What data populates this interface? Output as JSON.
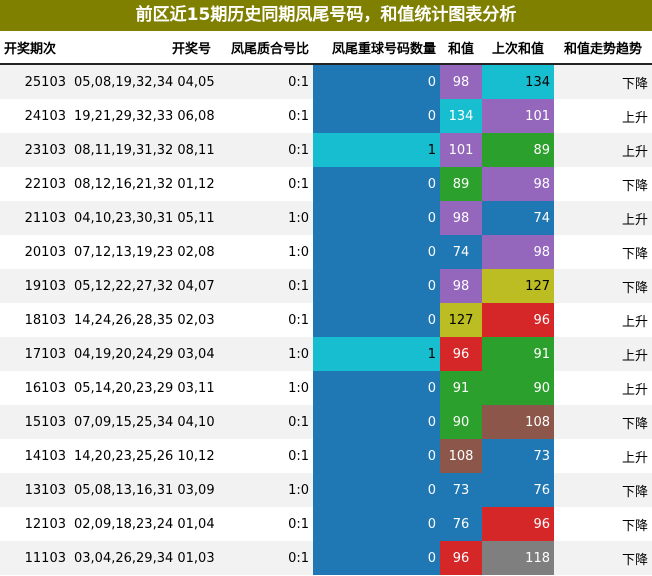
{
  "title": "前区近15期历史同期凤尾号码，和值统计图表分析",
  "headers": {
    "issue": "开奖期次",
    "numbers": "开奖号",
    "parity": "凤尾质合号比",
    "repeat": "凤尾重球号码数量",
    "sum": "和值",
    "prev_sum": "上次和值",
    "trend": "和值走势趋势"
  },
  "colors": {
    "title_bg": "#7f7f00",
    "blue": "#1f77b4",
    "cyan": "#17becf",
    "purple": "#9467bd",
    "green": "#2ca02c",
    "olive": "#bcbd22",
    "red": "#d62728",
    "brown": "#8c564b",
    "gray": "#7f7f7f"
  },
  "rows": [
    {
      "issue": "25103",
      "numbers": "05,08,19,32,34 04,05",
      "parity": "0:1",
      "repeat": "0",
      "repeat_color": "blue",
      "sum": "98",
      "sum_color": "purple",
      "prev_sum": "134",
      "prev_color": "cyan",
      "trend": "下降"
    },
    {
      "issue": "24103",
      "numbers": "19,21,29,32,33 06,08",
      "parity": "0:1",
      "repeat": "0",
      "repeat_color": "blue",
      "sum": "134",
      "sum_color": "cyan",
      "prev_sum": "101",
      "prev_color": "purple",
      "trend": "上升"
    },
    {
      "issue": "23103",
      "numbers": "08,11,19,31,32 08,11",
      "parity": "0:1",
      "repeat": "1",
      "repeat_color": "cyan",
      "sum": "101",
      "sum_color": "purple",
      "prev_sum": "89",
      "prev_color": "green",
      "trend": "上升"
    },
    {
      "issue": "22103",
      "numbers": "08,12,16,21,32 01,12",
      "parity": "0:1",
      "repeat": "0",
      "repeat_color": "blue",
      "sum": "89",
      "sum_color": "green",
      "prev_sum": "98",
      "prev_color": "purple",
      "trend": "下降"
    },
    {
      "issue": "21103",
      "numbers": "04,10,23,30,31 05,11",
      "parity": "1:0",
      "repeat": "0",
      "repeat_color": "blue",
      "sum": "98",
      "sum_color": "purple",
      "prev_sum": "74",
      "prev_color": "blue",
      "trend": "上升"
    },
    {
      "issue": "20103",
      "numbers": "07,12,13,19,23 02,08",
      "parity": "1:0",
      "repeat": "0",
      "repeat_color": "blue",
      "sum": "74",
      "sum_color": "blue",
      "prev_sum": "98",
      "prev_color": "purple",
      "trend": "下降"
    },
    {
      "issue": "19103",
      "numbers": "05,12,22,27,32 04,07",
      "parity": "0:1",
      "repeat": "0",
      "repeat_color": "blue",
      "sum": "98",
      "sum_color": "purple",
      "prev_sum": "127",
      "prev_color": "olive",
      "trend": "下降"
    },
    {
      "issue": "18103",
      "numbers": "14,24,26,28,35 02,03",
      "parity": "0:1",
      "repeat": "0",
      "repeat_color": "blue",
      "sum": "127",
      "sum_color": "olive",
      "prev_sum": "96",
      "prev_color": "red",
      "trend": "上升"
    },
    {
      "issue": "17103",
      "numbers": "04,19,20,24,29 03,04",
      "parity": "1:0",
      "repeat": "1",
      "repeat_color": "cyan",
      "sum": "96",
      "sum_color": "red",
      "prev_sum": "91",
      "prev_color": "green",
      "trend": "上升"
    },
    {
      "issue": "16103",
      "numbers": "05,14,20,23,29 03,11",
      "parity": "1:0",
      "repeat": "0",
      "repeat_color": "blue",
      "sum": "91",
      "sum_color": "green",
      "prev_sum": "90",
      "prev_color": "green",
      "trend": "上升"
    },
    {
      "issue": "15103",
      "numbers": "07,09,15,25,34 04,10",
      "parity": "0:1",
      "repeat": "0",
      "repeat_color": "blue",
      "sum": "90",
      "sum_color": "green",
      "prev_sum": "108",
      "prev_color": "brown",
      "trend": "下降"
    },
    {
      "issue": "14103",
      "numbers": "14,20,23,25,26 10,12",
      "parity": "0:1",
      "repeat": "0",
      "repeat_color": "blue",
      "sum": "108",
      "sum_color": "brown",
      "prev_sum": "73",
      "prev_color": "blue",
      "trend": "上升"
    },
    {
      "issue": "13103",
      "numbers": "05,08,13,16,31 03,09",
      "parity": "1:0",
      "repeat": "0",
      "repeat_color": "blue",
      "sum": "73",
      "sum_color": "blue",
      "prev_sum": "76",
      "prev_color": "blue",
      "trend": "下降"
    },
    {
      "issue": "12103",
      "numbers": "02,09,18,23,24 01,04",
      "parity": "0:1",
      "repeat": "0",
      "repeat_color": "blue",
      "sum": "76",
      "sum_color": "blue",
      "prev_sum": "96",
      "prev_color": "red",
      "trend": "下降"
    },
    {
      "issue": "11103",
      "numbers": "03,04,26,29,34 01,03",
      "parity": "0:1",
      "repeat": "0",
      "repeat_color": "blue",
      "sum": "96",
      "sum_color": "red",
      "prev_sum": "118",
      "prev_color": "gray",
      "trend": "下降"
    }
  ]
}
